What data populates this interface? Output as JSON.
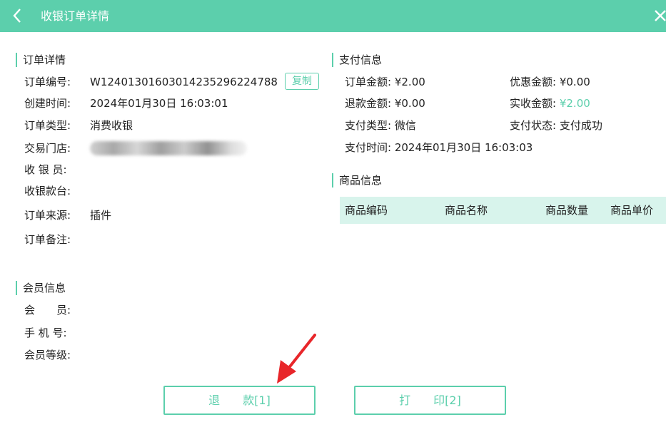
{
  "header": {
    "title": "收银订单详情",
    "back_icon": "chevron-left-icon",
    "close_icon": "close-icon"
  },
  "order": {
    "section_title": "订单详情",
    "order_no_label": "订单编号:",
    "order_no": "W124013016030142352962247​88",
    "copy_label": "复制",
    "created_label": "创建时间:",
    "created": "2024年01月30日 16:03:01",
    "type_label": "订单类型:",
    "type": "消费收银",
    "store_label": "交易门店:",
    "cashier_label": "收 银 员:",
    "counter_label": "收银款台:",
    "source_label": "订单来源:",
    "source": "插件",
    "remark_label": "订单备注:"
  },
  "member": {
    "section_title": "会员信息",
    "member_label": "会　　员:",
    "phone_label": "手 机 号:",
    "level_label": "会员等级:"
  },
  "payment": {
    "section_title": "支付信息",
    "order_amount_label": "订单金额:",
    "order_amount": "¥2.00",
    "discount_label": "优惠金额:",
    "discount": "¥0.00",
    "refund_label": "退款金额:",
    "refund": "¥0.00",
    "actual_label": "实收金额:",
    "actual": "¥2.00",
    "pay_type_label": "支付类型:",
    "pay_type": "微信",
    "pay_status_label": "支付状态:",
    "pay_status": "支付成功",
    "pay_time_label": "支付时间:",
    "pay_time": "2024年01月30日 16:03:03"
  },
  "goods": {
    "section_title": "商品信息",
    "columns": [
      "商品编码",
      "商品名称",
      "商品数量",
      "商品单价"
    ]
  },
  "actions": {
    "refund_button": "退　　款[1]",
    "print_button": "打　　印[2]"
  },
  "colors": {
    "accent": "#5ccfac",
    "header_bg": "#d8f4ec",
    "arrow": "#e8262a"
  }
}
